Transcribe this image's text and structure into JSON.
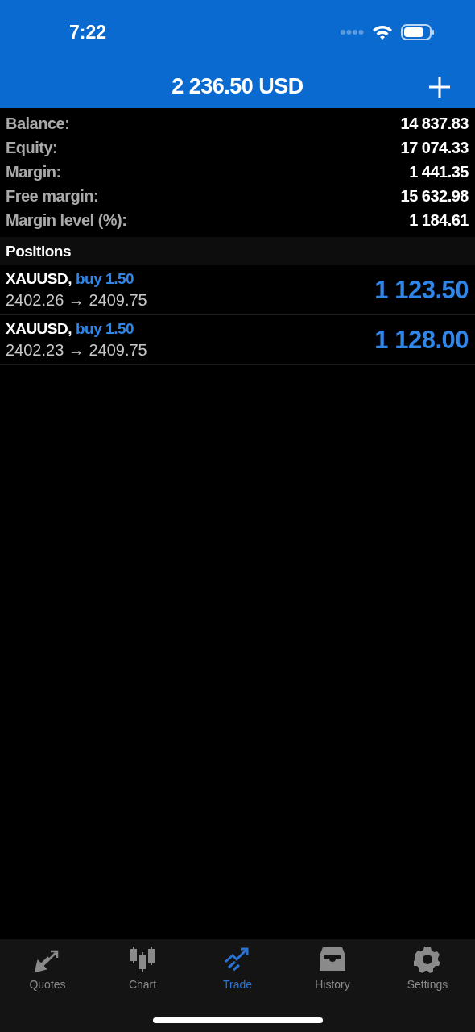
{
  "status_bar": {
    "time": "7:22"
  },
  "header": {
    "title": "2 236.50 USD"
  },
  "summary": [
    {
      "label": "Balance:",
      "value": "14 837.83"
    },
    {
      "label": "Equity:",
      "value": "17 074.33"
    },
    {
      "label": "Margin:",
      "value": "1 441.35"
    },
    {
      "label": "Free margin:",
      "value": "15 632.98"
    },
    {
      "label": "Margin level (%):",
      "value": "1 184.61"
    }
  ],
  "positions_header": "Positions",
  "positions": [
    {
      "symbol": "XAUUSD,",
      "order": "buy 1.50",
      "prices": "2402.26 → 2409.75",
      "profit": "1 123.50"
    },
    {
      "symbol": "XAUUSD,",
      "order": "buy 1.50",
      "prices": "2402.23 → 2409.75",
      "profit": "1 128.00"
    }
  ],
  "tabs": [
    {
      "label": "Quotes",
      "selected": false
    },
    {
      "label": "Chart",
      "selected": false
    },
    {
      "label": "Trade",
      "selected": true
    },
    {
      "label": "History",
      "selected": false
    },
    {
      "label": "Settings",
      "selected": false
    }
  ]
}
